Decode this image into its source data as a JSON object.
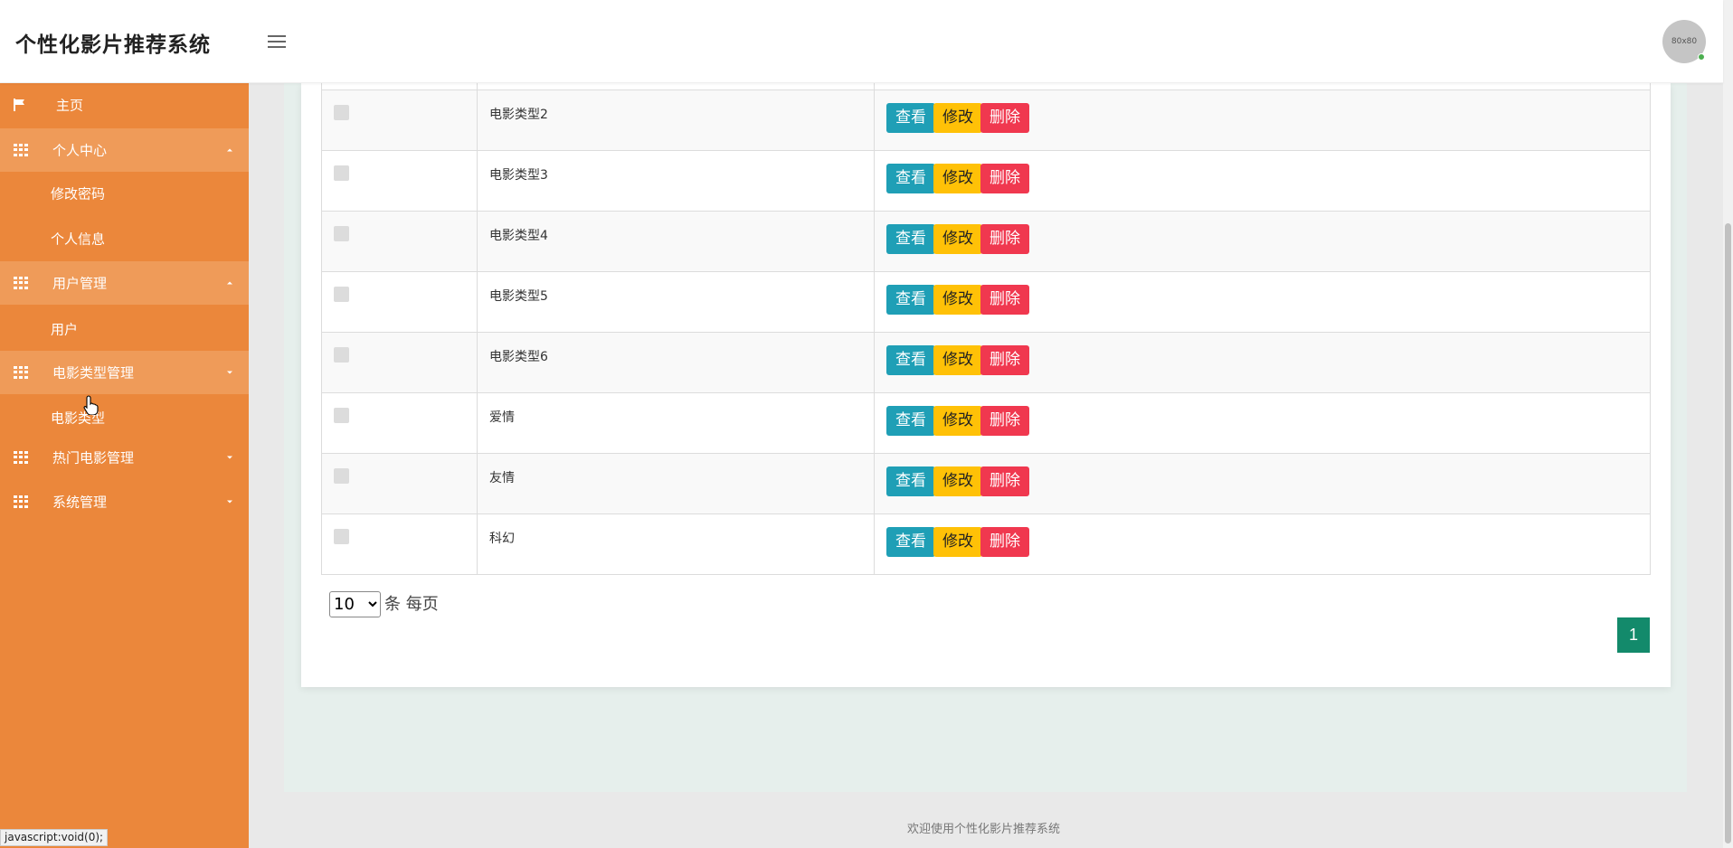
{
  "header": {
    "brand": "个性化影片推荐系统",
    "avatar_text": "80x80"
  },
  "sidebar": {
    "home": "主页",
    "personal_center": "个人中心",
    "change_password": "修改密码",
    "personal_info": "个人信息",
    "user_management": "用户管理",
    "user": "用户",
    "movie_type_management": "电影类型管理",
    "movie_type": "电影类型",
    "hot_movie_management": "热门电影管理",
    "system_management": "系统管理"
  },
  "table": {
    "rows": [
      {
        "name": "电影类型2"
      },
      {
        "name": "电影类型3"
      },
      {
        "name": "电影类型4"
      },
      {
        "name": "电影类型5"
      },
      {
        "name": "电影类型6"
      },
      {
        "name": "爱情"
      },
      {
        "name": "友情"
      },
      {
        "name": "科幻"
      }
    ],
    "view_label": "查看",
    "edit_label": "修改",
    "delete_label": "删除"
  },
  "pager": {
    "page_size": "10",
    "per_page_text": "条 每页",
    "current_page": "1"
  },
  "footer": {
    "text": "欢迎使用个性化影片推荐系统"
  },
  "status_url": "javascript:void(0);"
}
